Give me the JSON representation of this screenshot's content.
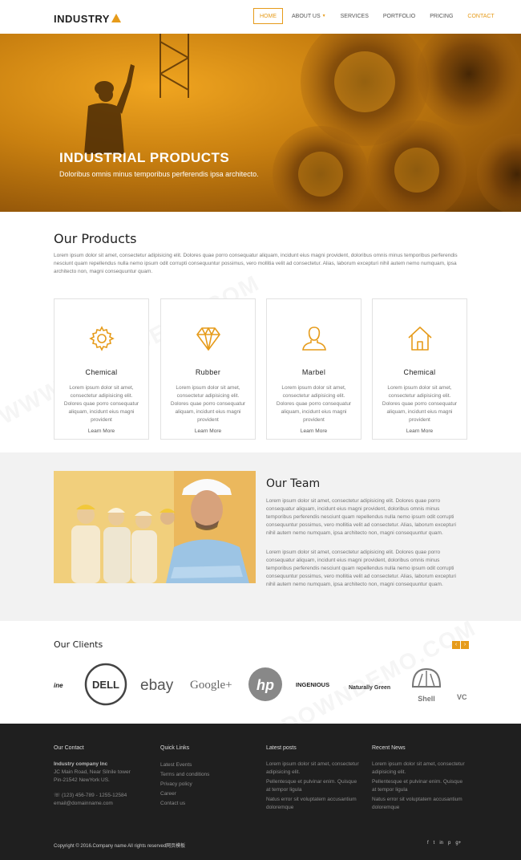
{
  "brand": {
    "name": "INDUSTRY",
    "accent": "#e69b1a"
  },
  "nav": [
    {
      "label": "HOME",
      "active": true
    },
    {
      "label": "ABOUT US",
      "dropdown": true
    },
    {
      "label": "SERVICES"
    },
    {
      "label": "PORTFOLIO"
    },
    {
      "label": "PRICING"
    },
    {
      "label": "CONTACT",
      "highlight": true
    }
  ],
  "hero": {
    "title": "INDUSTRIAL PRODUCTS",
    "subtitle": "Doloribus omnis minus temporibus perferendis ipsa architecto."
  },
  "products": {
    "title": "Our Products",
    "intro": "Lorem ipsum dolor sit amet, consectetur adipisicing elit. Dolores quae porro consequatur aliquam, incidunt eius magni provident, doloribus omnis minus temporibus perferendis nesciunt quam repellendus nulla nemo ipsum odit corrupti consequuntur possimus, vero mollitia velit ad consectetur. Alias, laborum excepturi nihil autem nemo numquam, ipsa architecto non, magni consequuntur quam.",
    "cards": [
      {
        "icon": "gear-icon",
        "title": "Chemical",
        "text": "Lorem ipsum dolor sit amet, consectetur adipisicing elit. Dolores quae porro consequatur aliquam, incidunt eius magni provident",
        "link": "Learn More"
      },
      {
        "icon": "diamond-icon",
        "title": "Rubber",
        "text": "Lorem ipsum dolor sit amet, consectetur adipisicing elit. Dolores quae porro consequatur aliquam, incidunt eius magni provident",
        "link": "Learn More"
      },
      {
        "icon": "user-icon",
        "title": "Marbel",
        "text": "Lorem ipsum dolor sit amet, consectetur adipisicing elit. Dolores quae porro consequatur aliquam, incidunt eius magni provident",
        "link": "Learn More"
      },
      {
        "icon": "home-icon",
        "title": "Chemical",
        "text": "Lorem ipsum dolor sit amet, consectetur adipisicing elit. Dolores quae porro consequatur aliquam, incidunt eius magni provident",
        "link": "Learn More"
      }
    ]
  },
  "team": {
    "title": "Our Team",
    "p1": "Lorem ipsum dolor sit amet, consectetur adipisicing elit. Dolores quae porro consequatur aliquam, incidunt eius magni provident, doloribus omnis minus temporibus perferendis nesciunt quam repellendus nulla nemo ipsum odit corrupti consequuntur possimus, vero mollitia velit ad consectetur. Alias, laborum excepturi nihil autem nemo numquam, ipsa architecto non, magni consequuntur quam.",
    "p2": "Lorem ipsum dolor sit amet, consectetur adipisicing elit. Dolores quae porro consequatur aliquam, incidunt eius magni provident, doloribus omnis minus temporibus perferendis nesciunt quam repellendus nulla nemo ipsum odit corrupti consequuntur possimus, vero mollitia velit ad consectetur. Alias, laborum excepturi nihil autem nemo numquam, ipsa architecto non, magni consequuntur quam."
  },
  "clients": {
    "title": "Our Clients",
    "prev": "‹",
    "next": "›",
    "logos": [
      "ine",
      "DELL",
      "ebay",
      "Google+",
      "hp",
      "INGENIOUS",
      "Naturally Green",
      "Shell",
      "VC"
    ]
  },
  "footer": {
    "contact": {
      "heading": "Our Contact",
      "company": "Industry company Inc",
      "address1": "JC Main Road, Near Silnile tower",
      "address2": "Pin-21542 NewYork US.",
      "phone": "(123) 456-789 - 1255-12584",
      "email": "email@domainname.com"
    },
    "quick_links": {
      "heading": "Quick Links",
      "items": [
        "Latest Events",
        "Terms and conditions",
        "Privacy policy",
        "Career",
        "Contact us"
      ]
    },
    "latest_posts": {
      "heading": "Latest posts",
      "items": [
        "Lorem ipsum dolor sit amet, consectetur adipisicing elit.",
        "Pellentesque et pulvinar enim. Quisque at tempor ligula",
        "Natus error sit voluptatem accusantium doloremque"
      ]
    },
    "recent_news": {
      "heading": "Recent News",
      "items": [
        "Lorem ipsum dolor sit amet, consectetur adipisicing elit.",
        "Pellentesque et pulvinar enim. Quisque at tempor ligula",
        "Natus error sit voluptatem accusantium doloremque"
      ]
    },
    "copyright": "Copyright © 2016.Company name All rights reserved网页模板",
    "social": [
      "f",
      "t",
      "in",
      "p",
      "g+"
    ]
  },
  "watermark": "WWW.DOWNDEMO.COM"
}
